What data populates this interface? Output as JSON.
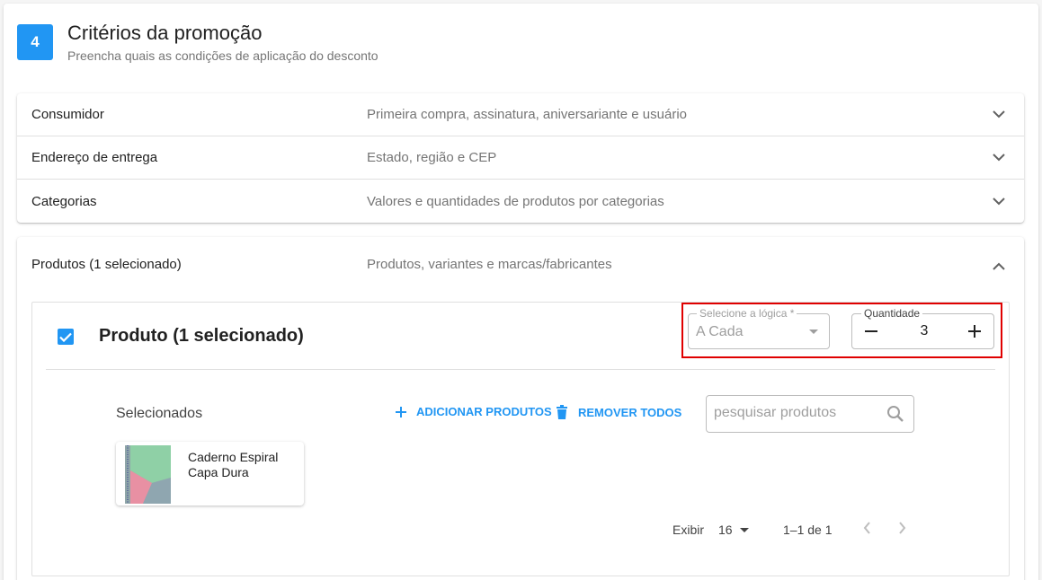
{
  "step": {
    "number": "4",
    "title": "Critérios da promoção",
    "subtitle": "Preencha quais as condições de aplicação do desconto"
  },
  "panels": [
    {
      "label": "Consumidor",
      "description": "Primeira compra, assinatura, aniversariante e usuário",
      "icon": "chevron-down-icon"
    },
    {
      "label": "Endereço de entrega",
      "description": "Estado, região e CEP",
      "icon": "chevron-down-icon"
    },
    {
      "label": "Categorias",
      "description": "Valores e quantidades de produtos por categorias",
      "icon": "chevron-down-icon"
    }
  ],
  "products_panel": {
    "label": "Produtos (1 selecionado)",
    "description": "Produtos, variantes e marcas/fabricantes",
    "icon": "chevron-up-icon",
    "product_block": {
      "title": "Produto (1 selecionado)",
      "checked": true,
      "logic_select": {
        "label": "Selecione a lógica *",
        "value": "A Cada"
      },
      "quantity": {
        "label": "Quantidade",
        "value": "3"
      },
      "selected_label": "Selecionados",
      "add_button": "ADICIONAR PRODUTOS",
      "remove_button": "REMOVER TODOS",
      "search_placeholder": "pesquisar produtos",
      "items": [
        {
          "name": "Caderno Espiral Capa Dura"
        }
      ],
      "pagination": {
        "label": "Exibir",
        "page_size": "16",
        "range": "1–1 de 1"
      }
    }
  },
  "colors": {
    "accent": "#2196f3",
    "highlight": "#e00000"
  }
}
